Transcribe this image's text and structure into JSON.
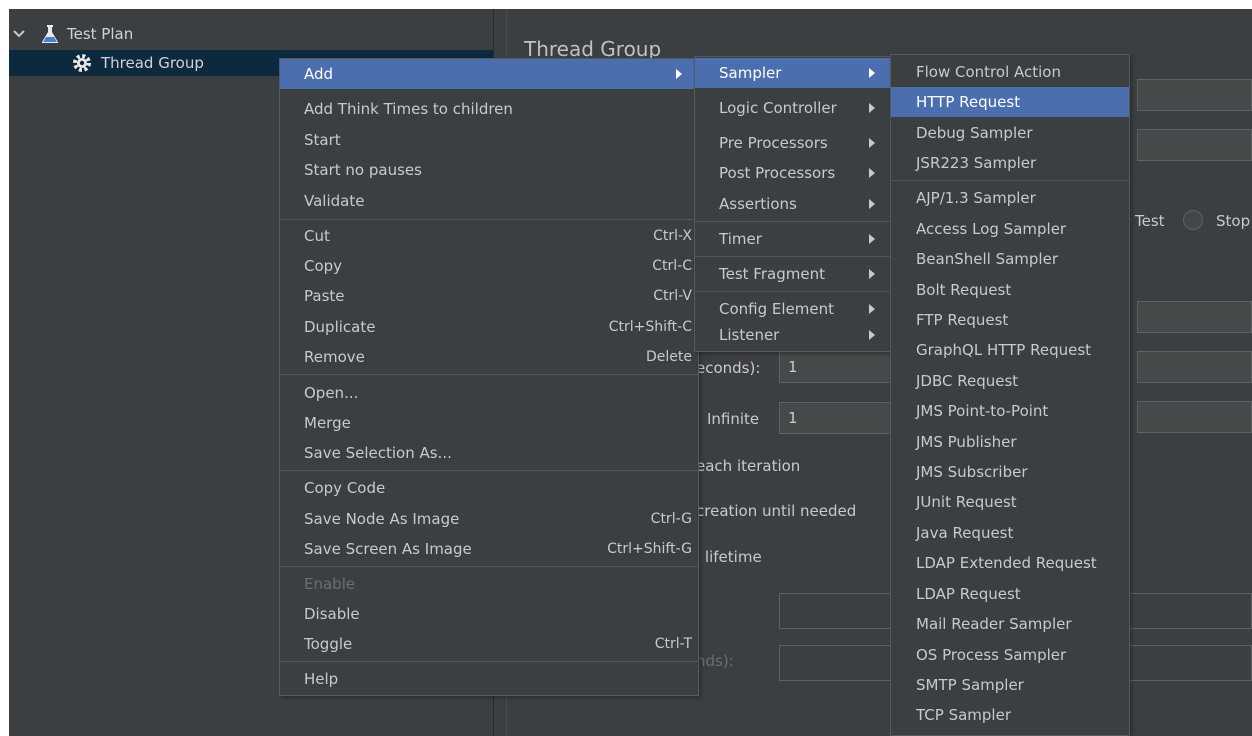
{
  "tree": {
    "items": [
      {
        "label": "Test Plan",
        "icon": "flask-icon"
      },
      {
        "label": "Thread Group",
        "icon": "gear-icon"
      }
    ]
  },
  "panel": {
    "title": "Thread Group",
    "fragments": {
      "test": "Test",
      "stop": "Stop",
      "seconds": "econds):",
      "ramp_value": "1",
      "infinite": "Infinite",
      "loop_value": "1",
      "each_iteration": "each iteration",
      "creation": "creation until needed",
      "lifetime": "l lifetime",
      "nds": "nds):"
    }
  },
  "context_menu": {
    "add": "Add",
    "add_think_times": "Add Think Times to children",
    "start": "Start",
    "start_no_pauses": "Start no pauses",
    "validate": "Validate",
    "cut": {
      "label": "Cut",
      "shortcut": "Ctrl-X"
    },
    "copy": {
      "label": "Copy",
      "shortcut": "Ctrl-C"
    },
    "paste": {
      "label": "Paste",
      "shortcut": "Ctrl-V"
    },
    "duplicate": {
      "label": "Duplicate",
      "shortcut": "Ctrl+Shift-C"
    },
    "remove": {
      "label": "Remove",
      "shortcut": "Delete"
    },
    "open": "Open...",
    "merge": "Merge",
    "save_selection_as": "Save Selection As...",
    "copy_code": "Copy Code",
    "save_node_as_image": {
      "label": "Save Node As Image",
      "shortcut": "Ctrl-G"
    },
    "save_screen_as_image": {
      "label": "Save Screen As Image",
      "shortcut": "Ctrl+Shift-G"
    },
    "enable": "Enable",
    "disable": "Disable",
    "toggle": {
      "label": "Toggle",
      "shortcut": "Ctrl-T"
    },
    "help": "Help"
  },
  "add_submenu": {
    "items": [
      "Sampler",
      "Logic Controller",
      "Pre Processors",
      "Post Processors",
      "Assertions",
      "Timer",
      "Test Fragment",
      "Config Element",
      "Listener"
    ]
  },
  "sampler_submenu": {
    "items": [
      "Flow Control Action",
      "HTTP Request",
      "Debug Sampler",
      "JSR223 Sampler",
      "AJP/1.3 Sampler",
      "Access Log Sampler",
      "BeanShell Sampler",
      "Bolt Request",
      "FTP Request",
      "GraphQL HTTP Request",
      "JDBC Request",
      "JMS Point-to-Point",
      "JMS Publisher",
      "JMS Subscriber",
      "JUnit Request",
      "Java Request",
      "LDAP Extended Request",
      "LDAP Request",
      "Mail Reader Sampler",
      "OS Process Sampler",
      "SMTP Sampler",
      "TCP Sampler"
    ]
  },
  "colors": {
    "background": "#3c3f41",
    "menu_selection": "#4b6eaf",
    "tree_selection": "#0d293e",
    "text": "#c9c9cc"
  }
}
